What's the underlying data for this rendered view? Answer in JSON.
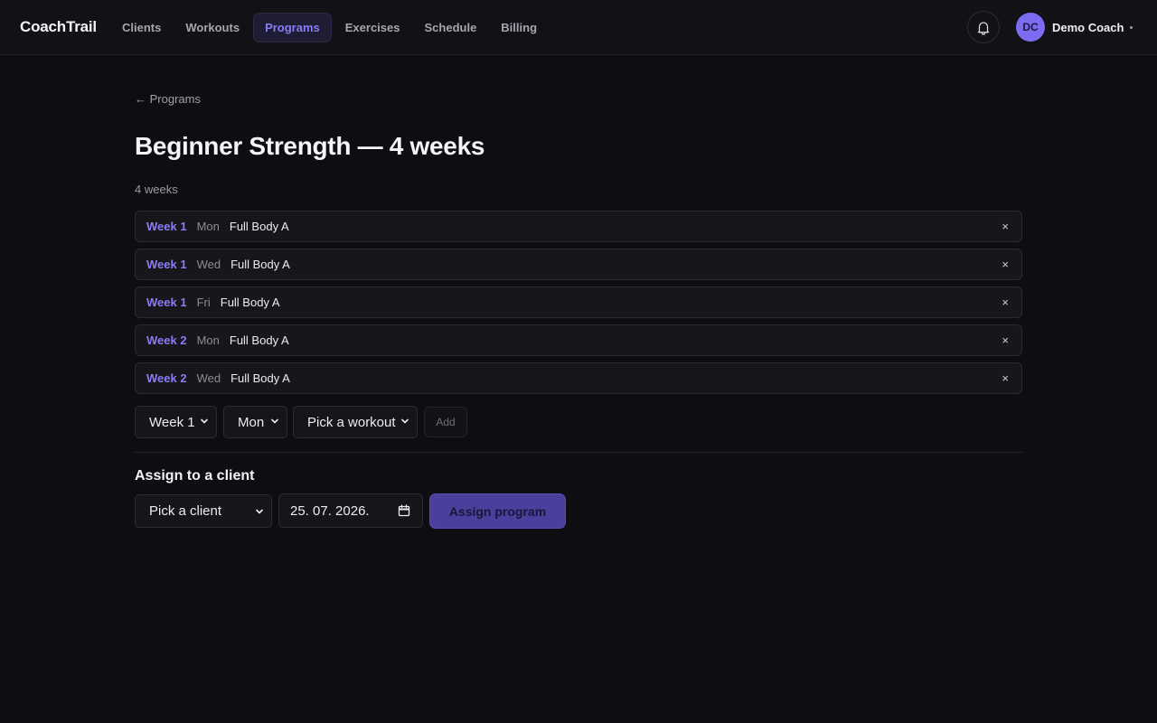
{
  "brand": "CoachTrail",
  "nav": [
    {
      "label": "Clients",
      "active": false
    },
    {
      "label": "Workouts",
      "active": false
    },
    {
      "label": "Programs",
      "active": true
    },
    {
      "label": "Exercises",
      "active": false
    },
    {
      "label": "Schedule",
      "active": false
    },
    {
      "label": "Billing",
      "active": false
    }
  ],
  "user": {
    "initials": "DC",
    "name": "Demo Coach"
  },
  "colors": {
    "accent": "#8b7cf6",
    "background": "#0e0e12",
    "primary_button": "#4b3f9e"
  },
  "icons": {
    "notifications": "bell-icon",
    "remove": "close-icon",
    "select": "chevron-down-icon",
    "date": "calendar-icon"
  },
  "breadcrumb": "← Programs",
  "program": {
    "title": "Beginner Strength — 4 weeks",
    "subtitle": "4 weeks"
  },
  "schedule": [
    {
      "week": "Week 1",
      "day": "Mon",
      "workout": "Full Body A",
      "remove": "×"
    },
    {
      "week": "Week 1",
      "day": "Wed",
      "workout": "Full Body A",
      "remove": "×"
    },
    {
      "week": "Week 1",
      "day": "Fri",
      "workout": "Full Body A",
      "remove": "×"
    },
    {
      "week": "Week 2",
      "day": "Mon",
      "workout": "Full Body A",
      "remove": "×"
    },
    {
      "week": "Week 2",
      "day": "Wed",
      "workout": "Full Body A",
      "remove": "×"
    }
  ],
  "add_form": {
    "week": "Week 1",
    "day": "Mon",
    "workout": "Pick a workout",
    "add_label": "Add"
  },
  "assign": {
    "heading": "Assign to a client",
    "client": "Pick a client",
    "date": "25. 07. 2026.",
    "button": "Assign program"
  }
}
